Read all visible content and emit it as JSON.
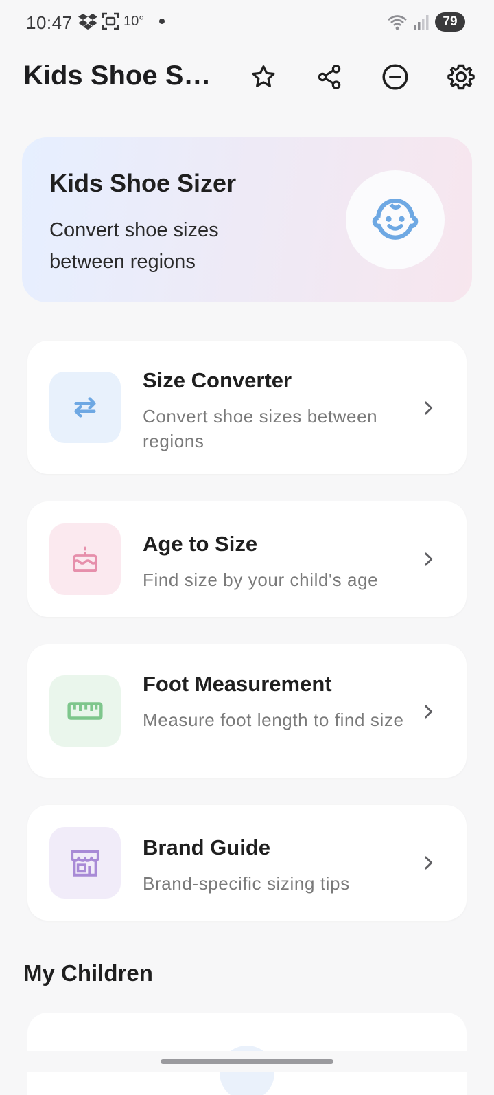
{
  "status_bar": {
    "time": "10:47",
    "temperature": "10°",
    "battery": "79"
  },
  "app_bar": {
    "title": "Kids Shoe Sizer",
    "icons": [
      "star-icon",
      "share-icon",
      "minus-circle-icon",
      "gear-icon"
    ]
  },
  "hero": {
    "title": "Kids Shoe Sizer",
    "subtitle": "Convert shoe sizes between regions",
    "icon": "baby-face-icon"
  },
  "features": [
    {
      "title": "Size Converter",
      "description": "Convert shoe sizes between regions",
      "icon": "swap-arrows-icon",
      "tint": "#e8f1fc",
      "icon_color": "#6ea8e3"
    },
    {
      "title": "Age to Size",
      "description": "Find size by your child's age",
      "icon": "cake-icon",
      "tint": "#fbe9ef",
      "icon_color": "#e68fab"
    },
    {
      "title": "Foot Measurement",
      "description": "Measure foot length to find size",
      "icon": "ruler-icon",
      "tint": "#eaf6ec",
      "icon_color": "#7ec68c"
    },
    {
      "title": "Brand Guide",
      "description": "Brand-specific sizing tips",
      "icon": "store-icon",
      "tint": "#f1ecf9",
      "icon_color": "#a88ad6"
    }
  ],
  "children_section": {
    "title": "My Children"
  },
  "colors": {
    "background": "#f7f7f8",
    "card": "#ffffff",
    "text_primary": "#1f1f1f",
    "text_secondary": "#7a7a7a",
    "hero_icon": "#6ea8e3"
  }
}
